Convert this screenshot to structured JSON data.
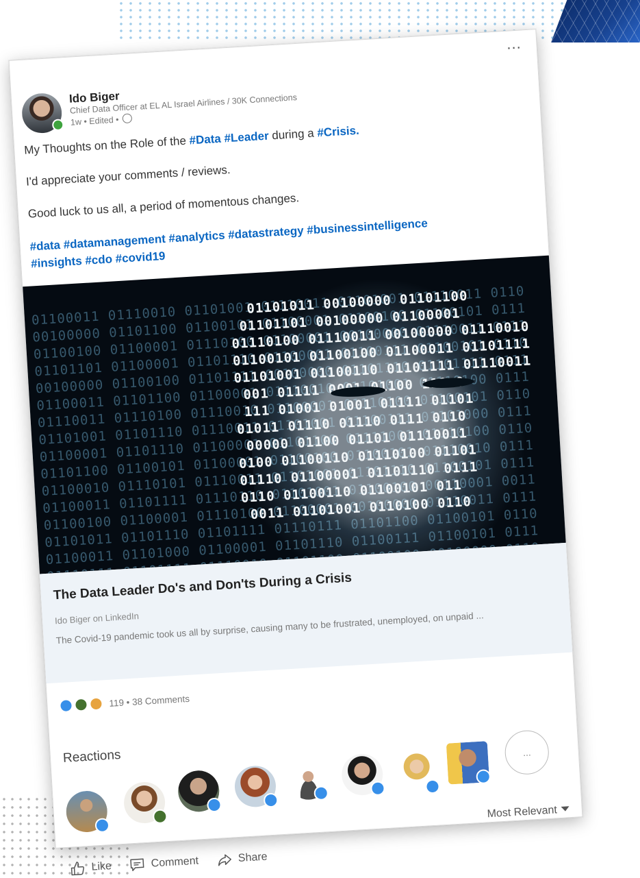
{
  "post": {
    "author": {
      "name": "Ido Biger",
      "headline": "Chief Data Officer at EL AL Israel Airlines / 30K Connections",
      "time": "1w • Edited •"
    },
    "menu_label": "...",
    "text": {
      "line1_prefix": "My Thoughts on the Role of the ",
      "tag_data": "#Data",
      "tag_leader": "#Leader",
      "line1_middle": " during a ",
      "tag_crisis": "#Crisis.",
      "line2": "I'd appreciate your comments / reviews.",
      "line3": "Good luck to us all, a period of momentous changes.",
      "hashtags_line1": "#data #datamanagement #analytics #datastrategy #businessintelligence",
      "hashtags_line2": "#insights #cdo #covid19"
    },
    "article": {
      "title": "The Data Leader Do's and Don'ts During a Crisis",
      "source": "Ido Biger on LinkedIn",
      "snippet": "The Covid-19 pandemic took us all by surprise, causing many to be frustrated, unemployed, on unpaid ..."
    },
    "social": {
      "counts": "119 • 38 Comments"
    },
    "reactions": {
      "heading": "Reactions",
      "more_label": "...",
      "sort_label": "Most Relevant"
    },
    "actions": {
      "like": "Like",
      "comment": "Comment",
      "share": "Share"
    }
  },
  "icons": [
    "more-icon",
    "globe-icon",
    "like-icon",
    "celebrate-icon",
    "insightful-icon",
    "thumbs-up-icon",
    "comment-icon",
    "share-icon",
    "caret-down-icon"
  ],
  "colors": {
    "link_blue": "#0a66c2",
    "like_blue": "#378fe9",
    "online_green": "#3ea33e"
  }
}
